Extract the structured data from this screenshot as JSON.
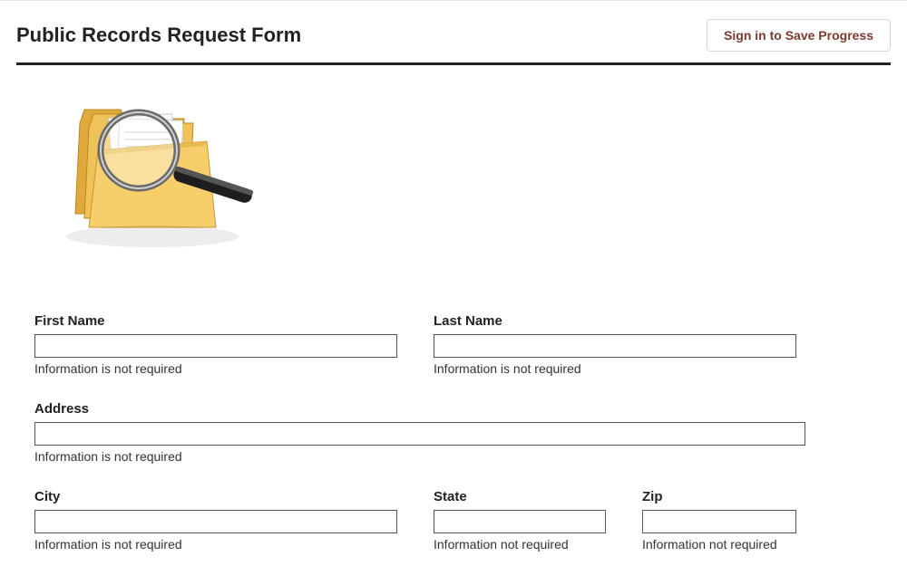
{
  "header": {
    "title": "Public Records Request Form",
    "save_button": "Sign in to Save Progress"
  },
  "fields": {
    "first_name": {
      "label": "First Name",
      "value": "",
      "hint": "Information is not required"
    },
    "last_name": {
      "label": "Last Name",
      "value": "",
      "hint": "Information is not required"
    },
    "address": {
      "label": "Address",
      "value": "",
      "hint": "Information is not required"
    },
    "city": {
      "label": "City",
      "value": "",
      "hint": "Information is not required"
    },
    "state": {
      "label": "State",
      "value": "",
      "hint": "Information not required"
    },
    "zip": {
      "label": "Zip",
      "value": "",
      "hint": "Information not required"
    }
  }
}
